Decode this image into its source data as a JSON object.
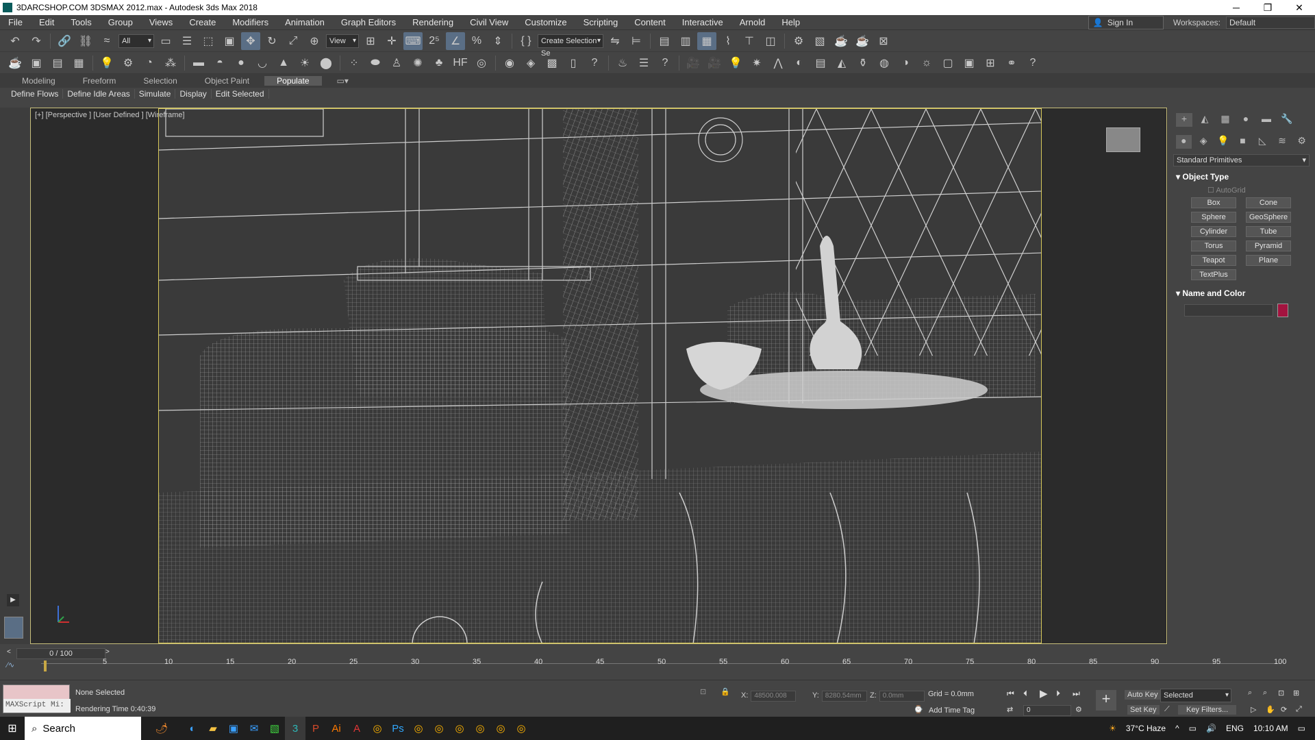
{
  "window": {
    "title": "3DARCSHOP.COM 3DSMAX 2012.max - Autodesk 3ds Max 2018",
    "minimize": "─",
    "maximize": "❐",
    "close": "✕"
  },
  "menu": [
    "File",
    "Edit",
    "Tools",
    "Group",
    "Views",
    "Create",
    "Modifiers",
    "Animation",
    "Graph Editors",
    "Rendering",
    "Civil View",
    "Customize",
    "Scripting",
    "Content",
    "Interactive",
    "Arnold",
    "Help"
  ],
  "signin": "Sign In",
  "workspaces": {
    "label": "Workspaces:",
    "value": "Default"
  },
  "toolbar": {
    "filter": "All",
    "refcoord": "View",
    "selset": "Create Selection Se"
  },
  "ribbon": {
    "tabs": [
      "Modeling",
      "Freeform",
      "Selection",
      "Object Paint",
      "Populate"
    ],
    "active": "Populate",
    "subtabs": [
      "Define Flows",
      "Define Idle Areas",
      "Simulate",
      "Display",
      "Edit Selected"
    ]
  },
  "viewport": {
    "label": "[+] [Perspective ] [User Defined ] [Wireframe]"
  },
  "command_panel": {
    "category": "Standard Primitives",
    "object_type_title": "Object Type",
    "autogrid": "AutoGrid",
    "buttons": [
      "Box",
      "Cone",
      "Sphere",
      "GeoSphere",
      "Cylinder",
      "Tube",
      "Torus",
      "Pyramid",
      "Teapot",
      "Plane",
      "TextPlus"
    ],
    "name_color_title": "Name and Color",
    "color": "#a3133f"
  },
  "timeline": {
    "frame": "0 / 100",
    "ticks": [
      "5",
      "10",
      "15",
      "20",
      "25",
      "30",
      "35",
      "40",
      "45",
      "50",
      "55",
      "60",
      "65",
      "70",
      "75",
      "80",
      "85",
      "90",
      "95",
      "100"
    ]
  },
  "status": {
    "selection": "None Selected",
    "render_time": "Rendering Time  0:40:39",
    "maxscript": "MAXScript Mi:",
    "x_label": "X:",
    "x_val": "48500.008",
    "y_label": "Y:",
    "y_val": "8280.54mm",
    "z_label": "Z:",
    "z_val": "0.0mm",
    "grid": "Grid = 0.0mm",
    "add_time_tag": "Add Time Tag",
    "auto_key": "Auto Key",
    "set_key": "Set Key",
    "selected": "Selected",
    "key_filters": "Key Filters...",
    "frame_field": "0"
  },
  "taskbar": {
    "search": "Search",
    "weather": "37°C  Haze",
    "lang": "ENG",
    "time": "10:10 AM"
  }
}
